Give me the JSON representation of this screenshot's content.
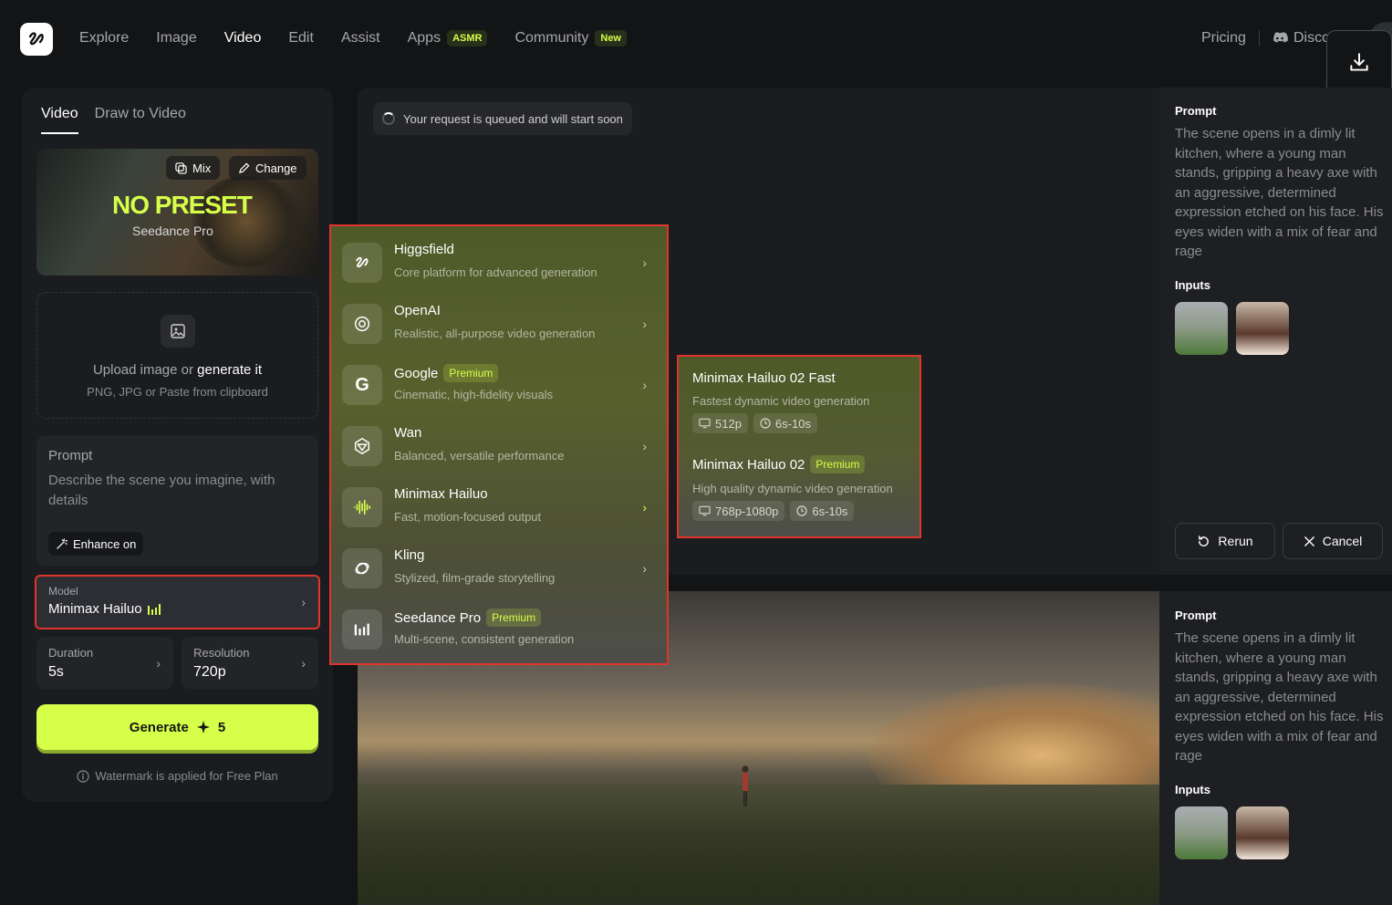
{
  "nav": {
    "items": [
      {
        "label": "Explore"
      },
      {
        "label": "Image"
      },
      {
        "label": "Video"
      },
      {
        "label": "Edit"
      },
      {
        "label": "Assist"
      },
      {
        "label": "Apps",
        "badge": "ASMR"
      },
      {
        "label": "Community",
        "badge": "New"
      }
    ],
    "pricing": "Pricing",
    "discord": "Disco"
  },
  "left": {
    "tabs": [
      "Video",
      "Draw to Video"
    ],
    "preset": {
      "title": "NO PRESET",
      "subtitle": "Seedance Pro",
      "mix_label": "Mix",
      "change_label": "Change"
    },
    "upload": {
      "text_prefix": "Upload image or",
      "text_action": "generate it",
      "sub": "PNG, JPG or Paste from clipboard"
    },
    "prompt": {
      "label": "Prompt",
      "placeholder": "Describe the scene you imagine, with details",
      "enhance_label": "Enhance on"
    },
    "model": {
      "label": "Model",
      "value": "Minimax Hailuo"
    },
    "duration": {
      "label": "Duration",
      "value": "5s"
    },
    "resolution": {
      "label": "Resolution",
      "value": "720p"
    },
    "generate": {
      "label": "Generate",
      "cost": "5"
    },
    "watermark": "Watermark is applied for Free Plan"
  },
  "queue": {
    "text": "Your request is queued and will start soon"
  },
  "result_info": {
    "prompt_label": "Prompt",
    "prompt_text": "The scene opens in a dimly lit kitchen, where a young man stands, gripping a heavy axe with an aggressive, determined expression etched on his face. His eyes widen with a mix of fear and rage",
    "inputs_label": "Inputs",
    "rerun_label": "Rerun",
    "cancel_label": "Cancel"
  },
  "result_info_2": {
    "prompt_label": "Prompt",
    "prompt_text": "The scene opens in a dimly lit kitchen, where a young man stands, gripping a heavy axe with an aggressive, determined expression etched on his face. His eyes widen with a mix of fear and rage",
    "inputs_label": "Inputs"
  },
  "model_menu": [
    {
      "name": "Higgsfield",
      "desc": "Core platform for advanced generation",
      "icon": "higgsfield-icon"
    },
    {
      "name": "OpenAI",
      "desc": "Realistic, all-purpose video generation",
      "icon": "openai-icon"
    },
    {
      "name": "Google",
      "badge": "Premium",
      "desc": "Cinematic, high-fidelity visuals",
      "icon": "google-icon"
    },
    {
      "name": "Wan",
      "desc": "Balanced, versatile performance",
      "icon": "wan-icon"
    },
    {
      "name": "Minimax Hailuo",
      "desc": "Fast, motion-focused output",
      "icon": "waveform-icon"
    },
    {
      "name": "Kling",
      "desc": "Stylized, film-grade storytelling",
      "icon": "kling-icon"
    },
    {
      "name": "Seedance Pro",
      "badge": "Premium",
      "desc": "Multi-scene, consistent generation",
      "icon": "bars-icon"
    }
  ],
  "submenu": [
    {
      "name": "Minimax Hailuo 02 Fast",
      "desc": "Fastest dynamic video generation",
      "resolution": "512p",
      "duration": "6s-10s"
    },
    {
      "name": "Minimax Hailuo 02",
      "badge": "Premium",
      "desc": "High quality dynamic video generation",
      "resolution": "768p-1080p",
      "duration": "6s-10s"
    }
  ],
  "colors": {
    "accent": "#d6ff4a",
    "highlight": "#e0342c",
    "bg": "#131416"
  }
}
